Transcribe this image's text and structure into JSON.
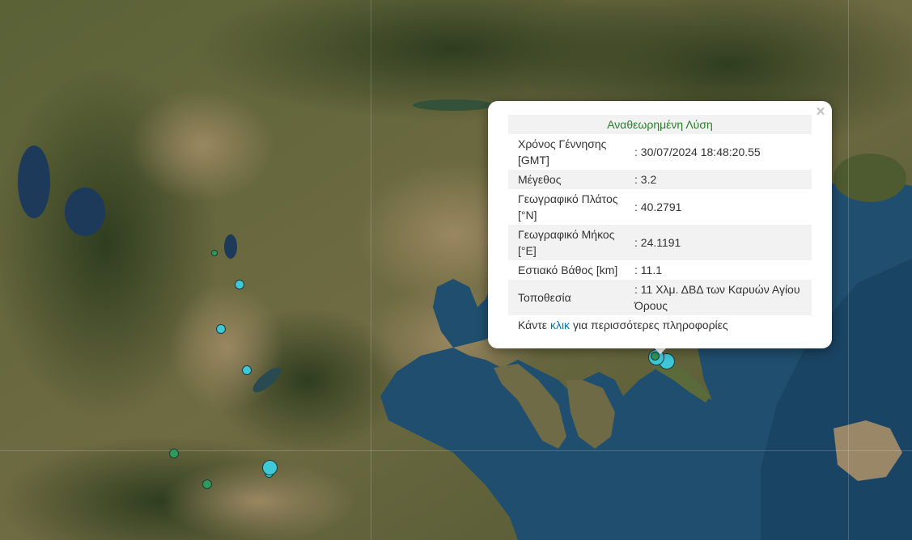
{
  "popup": {
    "header": "Αναθεωρημένη Λύση",
    "close_symbol": "×",
    "rows": [
      {
        "label": "Χρόνος Γέννησης [GMT]",
        "value": ": 30/07/2024 18:48:20.55"
      },
      {
        "label": "Μέγεθος",
        "value": ": 3.2"
      },
      {
        "label": "Γεωγραφικό Πλάτος [°N]",
        "value": ": 40.2791"
      },
      {
        "label": "Γεωγραφικό Μήκος [°E]",
        "value": ": 24.1191"
      },
      {
        "label": "Εστιακό Βάθος [km]",
        "value": ": 11.1"
      },
      {
        "label": "Τοποθεσία",
        "value": ": 11 Χλμ. ΔΒΔ των Καρυών Αγίου Όρους"
      }
    ],
    "more_prefix": "Κάντε",
    "more_link": "κλικ",
    "more_suffix": "για περισσότερες πληροφορίες"
  },
  "map": {
    "colors": {
      "land_dark": "#3f4a26",
      "land_mid": "#6b6a3f",
      "land_light": "#8a7a55",
      "sea": "#1f4e6e",
      "sea_deep": "#1a4463",
      "lake": "#1e3a5a",
      "marker_cyan": "#3fc8d8",
      "marker_green": "#2e9a5a"
    }
  }
}
